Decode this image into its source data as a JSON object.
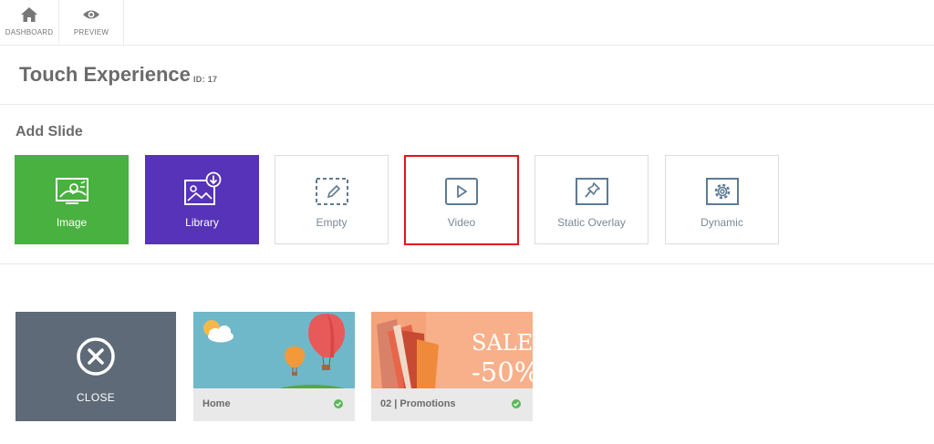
{
  "nav": {
    "dashboard": {
      "label": "DASHBOARD",
      "icon": "home-icon"
    },
    "preview": {
      "label": "PREVIEW",
      "icon": "eye-icon"
    }
  },
  "page": {
    "title": "Touch Experience",
    "id_label": "ID: 17"
  },
  "add_slide": {
    "heading": "Add Slide",
    "tiles": [
      {
        "label": "Image",
        "icon": "landscape-image-icon",
        "color": "#48b13f"
      },
      {
        "label": "Library",
        "icon": "image-library-download-icon",
        "color": "#5633b8"
      },
      {
        "label": "Empty",
        "icon": "dashed-pencil-icon"
      },
      {
        "label": "Video",
        "icon": "play-icon",
        "highlight": "#e3141b"
      },
      {
        "label": "Static Overlay",
        "icon": "pin-icon"
      },
      {
        "label": "Dynamic",
        "icon": "gear-icon"
      }
    ]
  },
  "slides": {
    "close": {
      "label": "CLOSE",
      "icon": "close-circle-icon",
      "color": "#5e6a77"
    },
    "items": [
      {
        "name": "Home",
        "status_icon": "check-circle-icon",
        "status_color": "#5cb85c"
      },
      {
        "name": "02 | Promotions",
        "status_icon": "check-circle-icon",
        "status_color": "#5cb85c",
        "thumb_text_1": "SALES",
        "thumb_text_2": "-50%"
      }
    ]
  }
}
